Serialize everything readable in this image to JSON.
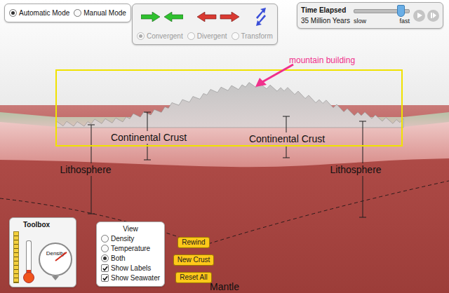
{
  "mode_options": [
    {
      "label": "Automatic Mode",
      "selected": true
    },
    {
      "label": "Manual Mode",
      "selected": false
    }
  ],
  "plate_motion": {
    "arrows": [
      {
        "kind": "convergent",
        "color": "#2fc12f"
      },
      {
        "kind": "divergent",
        "color": "#d93a32"
      },
      {
        "kind": "transform",
        "color": "#3a4fd8"
      }
    ],
    "boundary_types": [
      {
        "label": "Convergent",
        "selected": true,
        "disabled": true
      },
      {
        "label": "Divergent",
        "selected": false,
        "disabled": true
      },
      {
        "label": "Transform",
        "selected": false,
        "disabled": true
      }
    ]
  },
  "time": {
    "title": "Time Elapsed",
    "value": "35 Million Years",
    "speed": {
      "min_label": "slow",
      "max_label": "fast",
      "level": 0.85
    },
    "controls": [
      {
        "kind": "play",
        "disabled": true
      },
      {
        "kind": "step",
        "disabled": true
      }
    ]
  },
  "annotation": {
    "text": "mountain building",
    "color": "#f0308c"
  },
  "scene_labels": [
    {
      "text": "Continental Crust"
    },
    {
      "text": "Continental Crust"
    },
    {
      "text": "Lithosphere"
    },
    {
      "text": "Lithosphere"
    },
    {
      "text": "Mantle"
    }
  ],
  "toolbox": {
    "title": "Toolbox",
    "thermometer_level": 0.1,
    "density_gauge": {
      "label": "Density",
      "level": 0.72
    }
  },
  "view": {
    "title": "View",
    "options": [
      {
        "label": "Density",
        "selected": false
      },
      {
        "label": "Temperature",
        "selected": false
      },
      {
        "label": "Both",
        "selected": true
      }
    ],
    "checkboxes": [
      {
        "label": "Show Labels",
        "checked": true
      },
      {
        "label": "Show Seawater",
        "checked": true
      }
    ]
  },
  "buttons": [
    "Rewind",
    "New Crust",
    "Reset All"
  ]
}
